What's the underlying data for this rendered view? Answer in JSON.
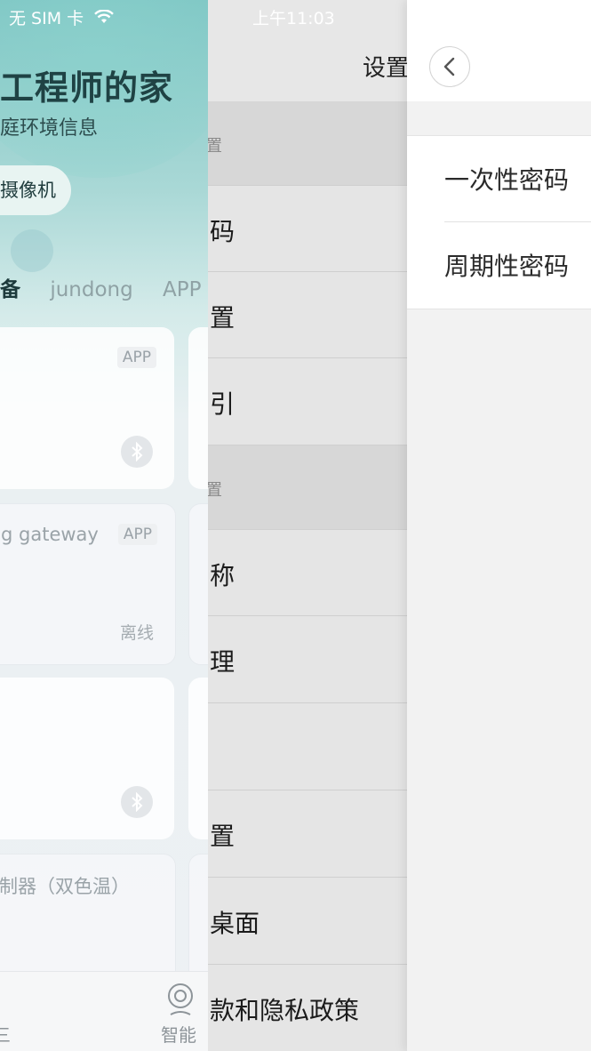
{
  "status_bar": {
    "carrier": "无 SIM 卡",
    "time": "上午11:03"
  },
  "home": {
    "title": "工程师的家",
    "subtitle": "庭环境信息",
    "camera_button": "摄像机",
    "tabs": [
      "备",
      "jundong",
      "APP"
    ],
    "cards": [
      {
        "badge": "APP",
        "name": "",
        "status": ""
      },
      {
        "badge": "APP",
        "name": "g gateway",
        "status": "离线"
      },
      {
        "badge": "",
        "name": "",
        "status": ""
      },
      {
        "badge": "",
        "name": "制器（双色温）",
        "status": ""
      }
    ],
    "bottom_nav": {
      "left_label": "三",
      "smart_label": "智能"
    }
  },
  "settings": {
    "title": "设置",
    "rows": [
      {
        "label": "置",
        "section": true
      },
      {
        "label": "码",
        "section": false
      },
      {
        "label": "置",
        "section": false
      },
      {
        "label": "引",
        "section": false
      },
      {
        "label": "置",
        "section": true
      },
      {
        "label": "称",
        "section": false
      },
      {
        "label": "理",
        "section": false
      },
      {
        "label": "",
        "section": false
      },
      {
        "label": "置",
        "section": false
      },
      {
        "label": "桌面",
        "section": false
      },
      {
        "label": "款和隐私政策",
        "section": false
      }
    ]
  },
  "password_panel": {
    "items": [
      "一次性密码",
      "周期性密码"
    ]
  }
}
